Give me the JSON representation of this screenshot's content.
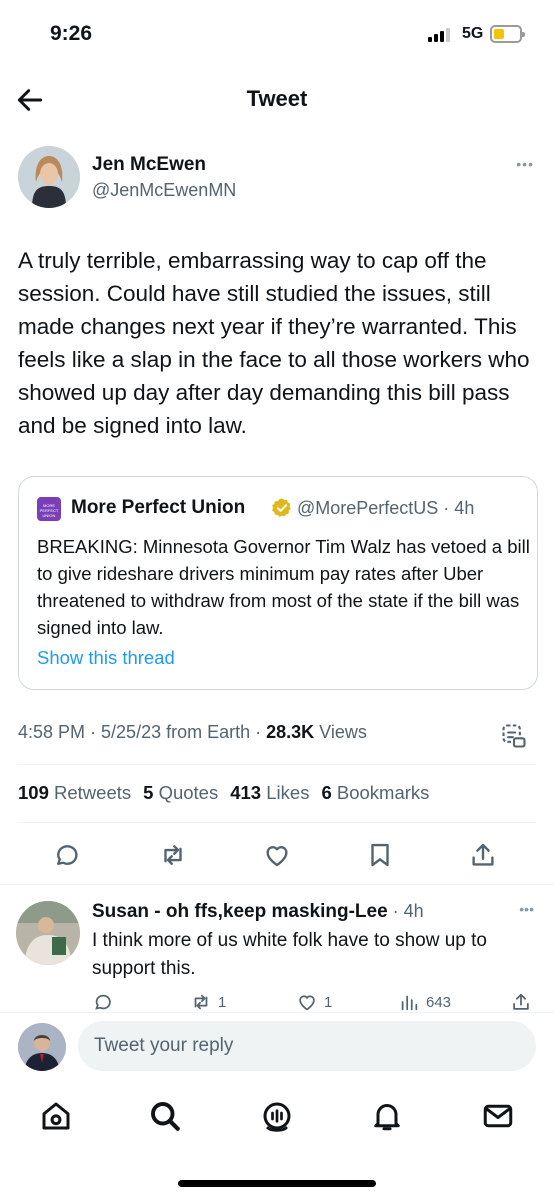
{
  "status_bar": {
    "time": "9:26",
    "network": "5G"
  },
  "header": {
    "title": "Tweet"
  },
  "tweet": {
    "author_name": "Jen McEwen",
    "author_handle": "@JenMcEwenMN",
    "text": "A truly terrible, embarrassing way to cap off the session. Could have still studied the issues, still made changes next year if they’re warranted. This feels like a slap in the face to all those workers who showed up day after day demanding this bill pass and be signed into law.",
    "quote": {
      "logo_text": "MORE PERFECT UNION",
      "name": "More Perfect Union",
      "handle_time": "@MorePerfectUS · 4h",
      "text": "BREAKING: Minnesota Governor Tim Walz has vetoed a bill to give rideshare drivers minimum pay rates after Uber threatened to withdraw from most of the state if the bill was signed into law.",
      "show_thread": "Show this thread"
    },
    "meta": {
      "timestamp": "4:58 PM · 5/25/23 from Earth · ",
      "views_count": "28.3K",
      "views_label": " Views"
    },
    "stats": {
      "retweets_count": "109",
      "retweets_label": "Retweets",
      "quotes_count": "5",
      "quotes_label": "Quotes",
      "likes_count": "413",
      "likes_label": "Likes",
      "bookmarks_count": "6",
      "bookmarks_label": "Bookmarks"
    }
  },
  "reply": {
    "name": "Susan - oh ffs,keep masking-Lee",
    "time": " · 4h",
    "text": "I think more of us white folk have to show up to support this.",
    "retweets": "1",
    "likes": "1",
    "views": "643"
  },
  "compose": {
    "placeholder": "Tweet your reply"
  },
  "colors": {
    "accent": "#1d9bf0",
    "secondary_text": "#536471",
    "verified": "#e2b719"
  },
  "icons": [
    "back-arrow-icon",
    "more-icon",
    "verified-badge-icon",
    "analytics-icon",
    "reply-icon",
    "retweet-icon",
    "like-icon",
    "bookmark-icon",
    "share-icon",
    "views-icon",
    "home-icon",
    "search-icon",
    "spaces-icon",
    "notifications-icon",
    "messages-icon"
  ]
}
